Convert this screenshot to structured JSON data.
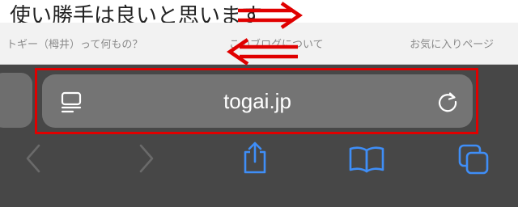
{
  "page": {
    "text": "使い勝手は良いと思います"
  },
  "nav": {
    "links": [
      "トギー（栂井）って何もの？",
      "このブログについて",
      "お気に入りページ"
    ]
  },
  "address_bar": {
    "url": "togai.jp"
  },
  "icons": {
    "reader": "reader-view-icon",
    "reload": "reload-icon",
    "back": "chevron-left-icon",
    "forward": "chevron-right-icon",
    "share": "share-icon",
    "bookmarks": "book-icon",
    "tabs": "tabs-icon",
    "annotation": "double-arrow-icon"
  },
  "colors": {
    "accent": "#3f8ef7",
    "disabled": "#6a6a6a",
    "highlight": "#e00000"
  }
}
